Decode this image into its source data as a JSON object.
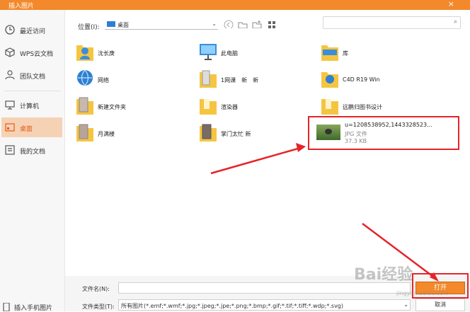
{
  "window": {
    "title": "插入图片",
    "close": "×"
  },
  "sidebar": {
    "items": [
      {
        "label": "最近访问",
        "icon": "clock-icon"
      },
      {
        "label": "WPS云文档",
        "icon": "cloud-icon"
      },
      {
        "label": "团队文档",
        "icon": "team-icon"
      },
      {
        "label": "计算机",
        "icon": "computer-icon"
      },
      {
        "label": "桌面",
        "icon": "desktop-icon"
      },
      {
        "label": "我的文档",
        "icon": "documents-icon"
      }
    ],
    "bottom": {
      "label": "插入手机图片",
      "icon": "phone-icon"
    }
  },
  "toolbar": {
    "location_label": "位置(I):",
    "location_value": "桌面",
    "search_placeholder": ""
  },
  "files": [
    {
      "name": "沈长庚",
      "icon": "user-folder-icon"
    },
    {
      "name": "此电脑",
      "icon": "pc-icon"
    },
    {
      "name": "库",
      "icon": "library-folder-icon"
    },
    {
      "name": "网络",
      "icon": "network-icon"
    },
    {
      "name": "1网课　新　新",
      "icon": "image-folder-icon"
    },
    {
      "name": "C4D R19 Win",
      "icon": "folder-icon"
    },
    {
      "name": "新建文件夹",
      "icon": "image-folder-icon"
    },
    {
      "name": "渲染器",
      "icon": "folder-icon"
    },
    {
      "name": "远鹏归图书设计",
      "icon": "folder-icon"
    },
    {
      "name": "月满楼",
      "icon": "image-folder-icon"
    },
    {
      "name": "掌门太忙 新",
      "icon": "image-folder-icon"
    }
  ],
  "selected_file": {
    "name": "u=1208538952,1443328523...",
    "type": "JPG 文件",
    "size": "37.3 KB"
  },
  "bottom": {
    "filename_label": "文件名(N):",
    "filename_value": "",
    "filetype_label": "文件类型(T):",
    "filetype_value": "所有图片(*.emf;*.wmf;*.jpg;*.jpeg;*.jpe;*.png;*.bmp;*.gif;*.tif;*.tiff;*.wdp;*.svg)",
    "open_label": "打开",
    "cancel_label": "取消"
  },
  "watermark": {
    "text": "Bai经验",
    "sub": "jingyan.baidu.com"
  },
  "colors": {
    "accent": "#f3892a",
    "annotation": "#e6232a"
  }
}
